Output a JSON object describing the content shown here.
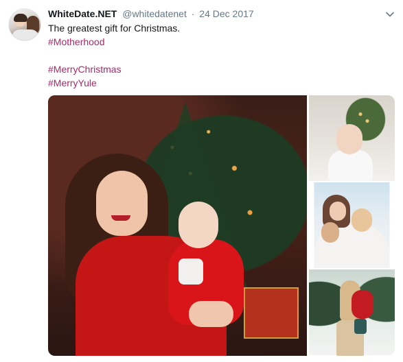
{
  "tweet": {
    "author_name": "WhiteDate.NET",
    "handle": "@whitedatenet",
    "separator": "·",
    "date": "24 Dec 2017",
    "text_line": "The greatest gift for Christmas.",
    "hashtags": [
      "#Motherhood",
      "#MerryChristmas",
      "#MerryYule"
    ]
  },
  "colors": {
    "hashtag": "#b0256b",
    "muted": "#657786",
    "text": "#14171a"
  },
  "icons": {
    "menu": "chevron-down-icon"
  },
  "media": {
    "photo_count": 4
  }
}
